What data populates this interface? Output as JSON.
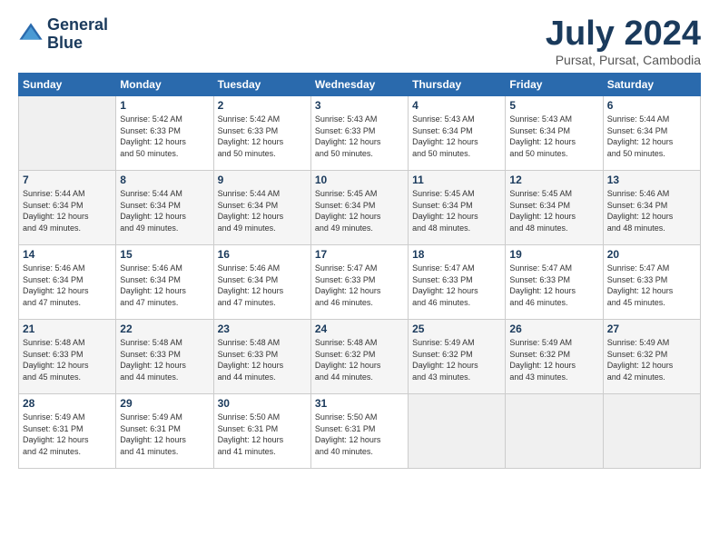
{
  "header": {
    "logo_line1": "General",
    "logo_line2": "Blue",
    "month": "July 2024",
    "location": "Pursat, Pursat, Cambodia"
  },
  "days_of_week": [
    "Sunday",
    "Monday",
    "Tuesday",
    "Wednesday",
    "Thursday",
    "Friday",
    "Saturday"
  ],
  "weeks": [
    [
      {
        "num": "",
        "info": ""
      },
      {
        "num": "1",
        "info": "Sunrise: 5:42 AM\nSunset: 6:33 PM\nDaylight: 12 hours\nand 50 minutes."
      },
      {
        "num": "2",
        "info": "Sunrise: 5:42 AM\nSunset: 6:33 PM\nDaylight: 12 hours\nand 50 minutes."
      },
      {
        "num": "3",
        "info": "Sunrise: 5:43 AM\nSunset: 6:33 PM\nDaylight: 12 hours\nand 50 minutes."
      },
      {
        "num": "4",
        "info": "Sunrise: 5:43 AM\nSunset: 6:34 PM\nDaylight: 12 hours\nand 50 minutes."
      },
      {
        "num": "5",
        "info": "Sunrise: 5:43 AM\nSunset: 6:34 PM\nDaylight: 12 hours\nand 50 minutes."
      },
      {
        "num": "6",
        "info": "Sunrise: 5:44 AM\nSunset: 6:34 PM\nDaylight: 12 hours\nand 50 minutes."
      }
    ],
    [
      {
        "num": "7",
        "info": "Sunrise: 5:44 AM\nSunset: 6:34 PM\nDaylight: 12 hours\nand 49 minutes."
      },
      {
        "num": "8",
        "info": "Sunrise: 5:44 AM\nSunset: 6:34 PM\nDaylight: 12 hours\nand 49 minutes."
      },
      {
        "num": "9",
        "info": "Sunrise: 5:44 AM\nSunset: 6:34 PM\nDaylight: 12 hours\nand 49 minutes."
      },
      {
        "num": "10",
        "info": "Sunrise: 5:45 AM\nSunset: 6:34 PM\nDaylight: 12 hours\nand 49 minutes."
      },
      {
        "num": "11",
        "info": "Sunrise: 5:45 AM\nSunset: 6:34 PM\nDaylight: 12 hours\nand 48 minutes."
      },
      {
        "num": "12",
        "info": "Sunrise: 5:45 AM\nSunset: 6:34 PM\nDaylight: 12 hours\nand 48 minutes."
      },
      {
        "num": "13",
        "info": "Sunrise: 5:46 AM\nSunset: 6:34 PM\nDaylight: 12 hours\nand 48 minutes."
      }
    ],
    [
      {
        "num": "14",
        "info": "Sunrise: 5:46 AM\nSunset: 6:34 PM\nDaylight: 12 hours\nand 47 minutes."
      },
      {
        "num": "15",
        "info": "Sunrise: 5:46 AM\nSunset: 6:34 PM\nDaylight: 12 hours\nand 47 minutes."
      },
      {
        "num": "16",
        "info": "Sunrise: 5:46 AM\nSunset: 6:34 PM\nDaylight: 12 hours\nand 47 minutes."
      },
      {
        "num": "17",
        "info": "Sunrise: 5:47 AM\nSunset: 6:33 PM\nDaylight: 12 hours\nand 46 minutes."
      },
      {
        "num": "18",
        "info": "Sunrise: 5:47 AM\nSunset: 6:33 PM\nDaylight: 12 hours\nand 46 minutes."
      },
      {
        "num": "19",
        "info": "Sunrise: 5:47 AM\nSunset: 6:33 PM\nDaylight: 12 hours\nand 46 minutes."
      },
      {
        "num": "20",
        "info": "Sunrise: 5:47 AM\nSunset: 6:33 PM\nDaylight: 12 hours\nand 45 minutes."
      }
    ],
    [
      {
        "num": "21",
        "info": "Sunrise: 5:48 AM\nSunset: 6:33 PM\nDaylight: 12 hours\nand 45 minutes."
      },
      {
        "num": "22",
        "info": "Sunrise: 5:48 AM\nSunset: 6:33 PM\nDaylight: 12 hours\nand 44 minutes."
      },
      {
        "num": "23",
        "info": "Sunrise: 5:48 AM\nSunset: 6:33 PM\nDaylight: 12 hours\nand 44 minutes."
      },
      {
        "num": "24",
        "info": "Sunrise: 5:48 AM\nSunset: 6:32 PM\nDaylight: 12 hours\nand 44 minutes."
      },
      {
        "num": "25",
        "info": "Sunrise: 5:49 AM\nSunset: 6:32 PM\nDaylight: 12 hours\nand 43 minutes."
      },
      {
        "num": "26",
        "info": "Sunrise: 5:49 AM\nSunset: 6:32 PM\nDaylight: 12 hours\nand 43 minutes."
      },
      {
        "num": "27",
        "info": "Sunrise: 5:49 AM\nSunset: 6:32 PM\nDaylight: 12 hours\nand 42 minutes."
      }
    ],
    [
      {
        "num": "28",
        "info": "Sunrise: 5:49 AM\nSunset: 6:31 PM\nDaylight: 12 hours\nand 42 minutes."
      },
      {
        "num": "29",
        "info": "Sunrise: 5:49 AM\nSunset: 6:31 PM\nDaylight: 12 hours\nand 41 minutes."
      },
      {
        "num": "30",
        "info": "Sunrise: 5:50 AM\nSunset: 6:31 PM\nDaylight: 12 hours\nand 41 minutes."
      },
      {
        "num": "31",
        "info": "Sunrise: 5:50 AM\nSunset: 6:31 PM\nDaylight: 12 hours\nand 40 minutes."
      },
      {
        "num": "",
        "info": ""
      },
      {
        "num": "",
        "info": ""
      },
      {
        "num": "",
        "info": ""
      }
    ]
  ]
}
